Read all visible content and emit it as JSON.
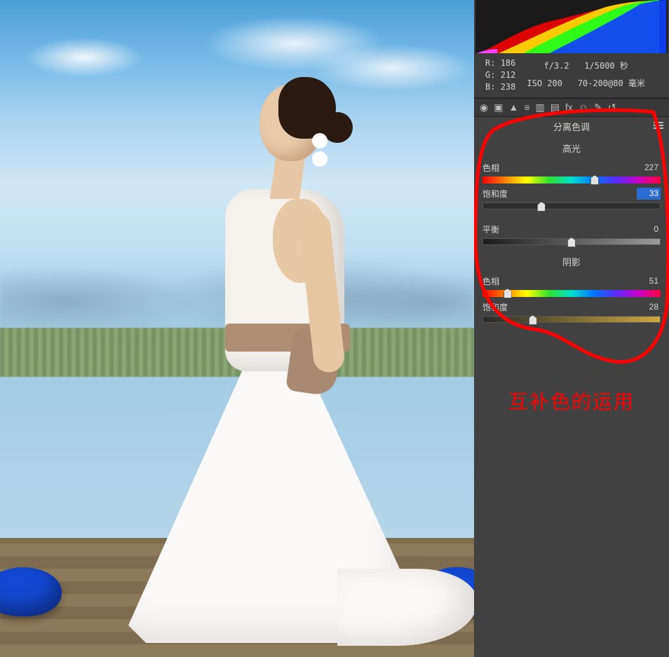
{
  "rgb": {
    "r_label": "R:",
    "r": "186",
    "g_label": "G:",
    "g": "212",
    "b_label": "B:",
    "b": "238"
  },
  "exif": {
    "line1_aperture": "f/3.2",
    "line1_shutter": "1/5000 秒",
    "line2_iso": "ISO 200",
    "line2_lens": "70-200@80 毫米"
  },
  "section_title": "分离色调",
  "highlights": {
    "header": "高光"
  },
  "shadows": {
    "header": "阴影"
  },
  "sliders": {
    "hue_h": {
      "label": "色相",
      "value": "227"
    },
    "sat_h": {
      "label": "饱和度",
      "value": "33"
    },
    "balance": {
      "label": "平衡",
      "value": "0"
    },
    "hue_s": {
      "label": "色相",
      "value": "51"
    },
    "sat_s": {
      "label": "饱和度",
      "value": "28"
    }
  },
  "annotation_text": "互补色的运用",
  "icons": {
    "aperture": "◉",
    "crop": "▣",
    "mountain": "▲",
    "lines": "≡",
    "panel": "▥",
    "bars": "▤",
    "fx": "fx",
    "people": "☺",
    "brush": "✎",
    "reset": "↺"
  }
}
